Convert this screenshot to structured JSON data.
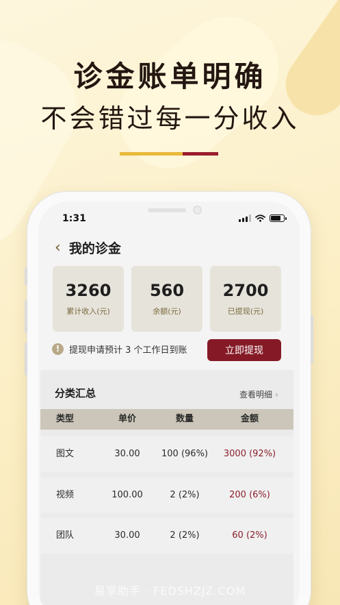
{
  "headline": {
    "line1": "诊金账单明确",
    "line2": "不会错过每一分收入"
  },
  "colors": {
    "accent_gold": "#e8b93a",
    "accent_red": "#9b1d2e",
    "button": "#851a26",
    "amount_text": "#8a1f2c"
  },
  "status_bar": {
    "time": "1:31",
    "icons": [
      "signal-icon",
      "wifi-icon",
      "battery-icon"
    ]
  },
  "nav": {
    "back_icon": "chevron-left-icon",
    "title": "我的诊金"
  },
  "stats": [
    {
      "value": "3260",
      "label": "累计收入(元)"
    },
    {
      "value": "560",
      "label": "余额(元)"
    },
    {
      "value": "2700",
      "label": "已提现(元)"
    }
  ],
  "notice": {
    "icon": "info-icon",
    "text": "提现申请预计 3 个工作日到账",
    "button_label": "立即提现"
  },
  "summary": {
    "title": "分类汇总",
    "detail_link": "查看明细",
    "columns": [
      "类型",
      "单价",
      "数量",
      "金额"
    ],
    "rows": [
      {
        "type": "图文",
        "price": "30.00",
        "qty": "100 (96%)",
        "amount": "3000 (92%)"
      },
      {
        "type": "视频",
        "price": "100.00",
        "qty": "2 (2%)",
        "amount": "200 (6%)"
      },
      {
        "type": "团队",
        "price": "30.00",
        "qty": "2 (2%)",
        "amount": "60 (2%)"
      }
    ]
  },
  "watermark": "易享助手 · FEDSHZJZ.COM"
}
